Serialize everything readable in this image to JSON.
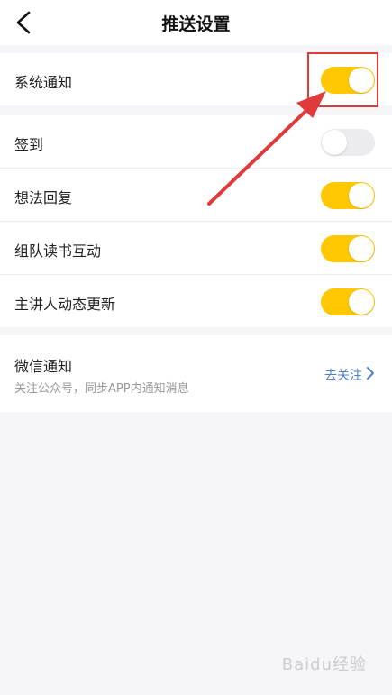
{
  "header": {
    "title": "推送设置",
    "back_icon": "chevron-left-icon"
  },
  "settings": [
    {
      "label": "系统通知",
      "on": true
    },
    {
      "label": "签到",
      "on": false
    },
    {
      "label": "想法回复",
      "on": true
    },
    {
      "label": "组队读书互动",
      "on": true
    },
    {
      "label": "主讲人动态更新",
      "on": true
    }
  ],
  "wechat": {
    "title": "微信通知",
    "subtitle": "关注公众号，同步APP内通知消息",
    "link": "去关注",
    "chevron_icon": "chevron-right-icon"
  },
  "watermark": "Baidu经验",
  "colors": {
    "toggle_on": "#ffc800",
    "toggle_off": "#ececef",
    "link": "#4d7fcc",
    "annotation": "#e03a3a"
  }
}
